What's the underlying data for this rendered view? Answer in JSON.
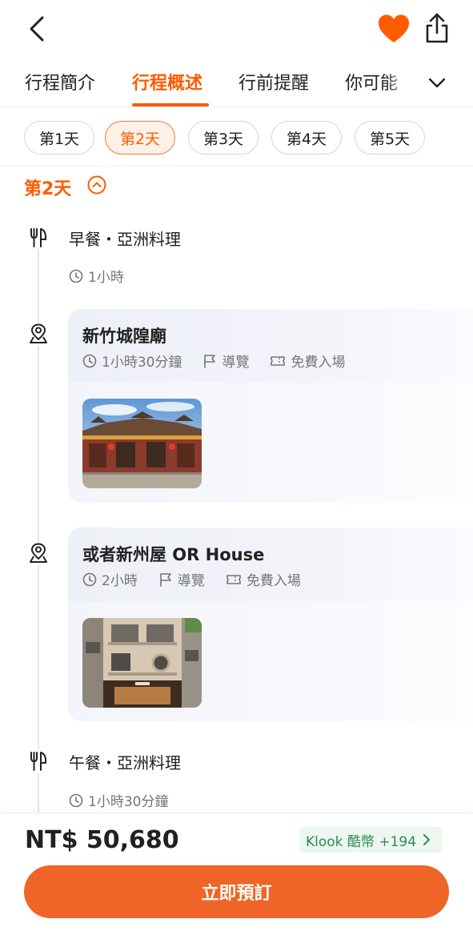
{
  "header": {
    "back_icon": "chevron-left-icon",
    "favorite_icon": "heart-icon",
    "favorite_color": "#ff5b00",
    "share_icon": "share-icon"
  },
  "tabs": [
    {
      "label": "行程簡介"
    },
    {
      "label": "行程概述",
      "active": true
    },
    {
      "label": "行前提醒"
    },
    {
      "label": "你可能"
    }
  ],
  "tabs_more_icon": "chevron-down-icon",
  "days": [
    {
      "label": "第1天"
    },
    {
      "label": "第2天",
      "active": true
    },
    {
      "label": "第3天"
    },
    {
      "label": "第4天"
    },
    {
      "label": "第5天"
    }
  ],
  "day_section": {
    "title": "第2天",
    "collapse_icon": "chevron-up-circle-icon"
  },
  "timeline": [
    {
      "kind": "meal",
      "icon": "fork-knife-icon",
      "title": "早餐・亞洲料理",
      "duration": "1小時"
    },
    {
      "kind": "attraction",
      "icon": "map-pin-icon",
      "title": "新竹城隍廟",
      "duration": "1小時30分鐘",
      "tag1": "導覽",
      "tag2": "免費入場",
      "image": "temple-photo"
    },
    {
      "kind": "attraction",
      "icon": "map-pin-icon",
      "title": "或者新州屋 OR House",
      "duration": "2小時",
      "tag1": "導覽",
      "tag2": "免費入場",
      "image": "building-photo"
    },
    {
      "kind": "meal",
      "icon": "fork-knife-icon",
      "title": "午餐・亞洲料理",
      "duration": "1小時30分鐘"
    }
  ],
  "footer": {
    "price": "NT$ 50,680",
    "coins": "Klook 酷幣 +194",
    "book_button": "立即預訂"
  },
  "colors": {
    "accent": "#ff5b00",
    "button": "#ef6427",
    "coin_bg": "#edf7ef",
    "coin_text": "#2f8b51"
  }
}
